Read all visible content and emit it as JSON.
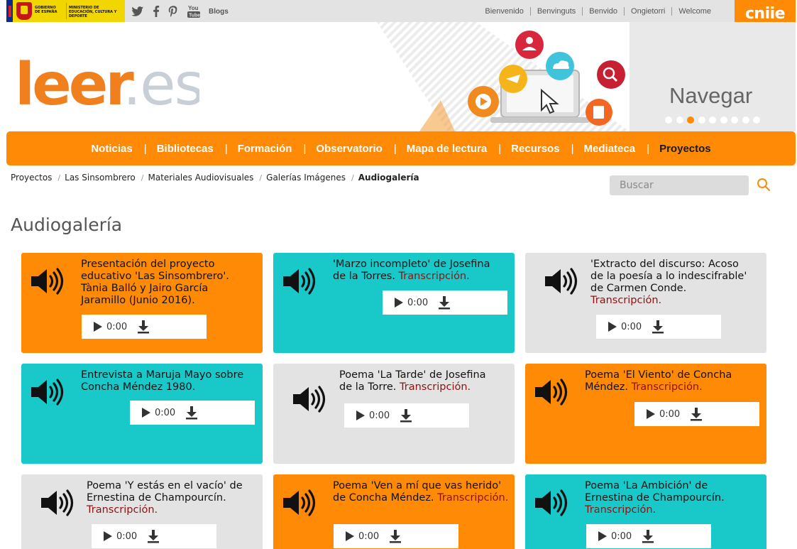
{
  "topbar": {
    "gov_text_1": "GOBIERNO DE ESPAÑA",
    "gov_text_2": "MINISTERIO DE EDUCACIÓN, CULTURA Y DEPORTE",
    "social": {
      "twitter": "twitter-icon",
      "facebook": "facebook-icon",
      "pinterest": "pinterest-icon",
      "youtube": "youtube-icon",
      "blogs_label": "Blogs"
    },
    "languages": [
      "Bienvenido",
      "Benvinguts",
      "Benvido",
      "Ongietorri",
      "Welcome"
    ],
    "brand": "cniie"
  },
  "header": {
    "logo_main": "leer",
    "logo_suffix": ".es",
    "carousel_label": "Navegar",
    "carousel_total": 9,
    "carousel_active": 3
  },
  "nav": {
    "items": [
      "Noticias",
      "Bibliotecas",
      "Formación",
      "Observatorio",
      "Mapa de lectura",
      "Recursos",
      "Mediateca",
      "Proyectos"
    ],
    "active_index": 7
  },
  "breadcrumb": [
    "Proyectos",
    "Las Sinsombrero",
    "Materiales Audiovisuales",
    "Galerías Imágenes",
    "Audiogalería"
  ],
  "search": {
    "placeholder": "Buscar"
  },
  "page_title": "Audiogalería",
  "colors": {
    "orange": "#fe8a05",
    "teal": "#19c9c9",
    "gray": "#e3e3e3",
    "link": "#8b1310"
  },
  "cards": [
    {
      "title": "Presentación del proyecto educativo 'Las Sinsombrero'. Tània Balló y Jairo García Jaramillo (Junio 2016).",
      "link": "",
      "time": "0:00",
      "color": "orange"
    },
    {
      "title": "'Marzo incompleto' de Josefina de la Torres.",
      "link": "Transcripción.",
      "time": "0:00",
      "color": "teal"
    },
    {
      "title": "'Extracto del discurso: Acoso de la poesía a lo indescifrable' de Carmen Conde.",
      "link": "Transcripción.",
      "time": "0:00",
      "color": "gray"
    },
    {
      "title": "Entrevista a Maruja Mayo sobre Concha Méndez 1980.",
      "link": "",
      "time": "0:00",
      "color": "teal"
    },
    {
      "title": "Poema 'La Tarde' de Josefina de la Torre.",
      "link": "Transcripción.",
      "time": "0:00",
      "color": "gray"
    },
    {
      "title": "Poema 'El Viento' de Concha Méndez.",
      "link": "Transcripción.",
      "time": "0:00",
      "color": "orange"
    },
    {
      "title": "Poema 'Y estás en el vacío' de Ernestina de Champourcín.",
      "link": "Transcripción.",
      "time": "0:00",
      "color": "gray"
    },
    {
      "title": "Poema 'Ven a mí que vas herido' de Concha Méndez.",
      "link": "Transcripción.",
      "time": "0:00",
      "color": "orange"
    },
    {
      "title": "Poema 'La Ambición' de Ernestina de Champourcín.",
      "link": "Transcripción.",
      "time": "0:00",
      "color": "teal"
    }
  ]
}
